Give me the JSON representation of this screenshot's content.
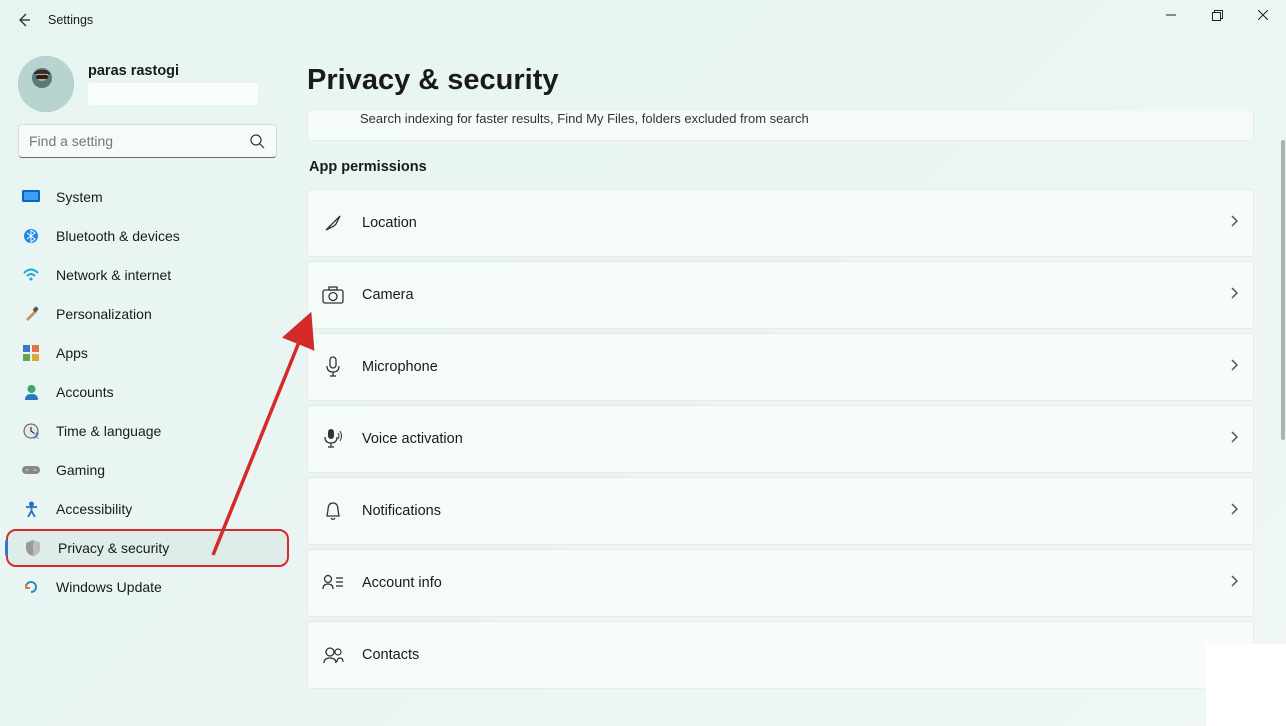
{
  "app_title": "Settings",
  "window_controls": {
    "minimize": "—",
    "maximize": "◻",
    "close": "✕"
  },
  "profile": {
    "name": "paras rastogi"
  },
  "search": {
    "placeholder": "Find a setting"
  },
  "sidebar": {
    "items": [
      {
        "label": "System",
        "icon": "monitor"
      },
      {
        "label": "Bluetooth & devices",
        "icon": "bluetooth"
      },
      {
        "label": "Network & internet",
        "icon": "wifi"
      },
      {
        "label": "Personalization",
        "icon": "brush"
      },
      {
        "label": "Apps",
        "icon": "apps"
      },
      {
        "label": "Accounts",
        "icon": "person"
      },
      {
        "label": "Time & language",
        "icon": "clock"
      },
      {
        "label": "Gaming",
        "icon": "gamepad"
      },
      {
        "label": "Accessibility",
        "icon": "accessibility"
      },
      {
        "label": "Privacy & security",
        "icon": "shield",
        "active": true,
        "highlighted": true
      },
      {
        "label": "Windows Update",
        "icon": "update"
      }
    ]
  },
  "page": {
    "title": "Privacy & security",
    "top_card_desc": "Search indexing for faster results, Find My Files, folders excluded from search",
    "section_heading": "App permissions",
    "permissions": [
      {
        "label": "Location",
        "icon": "location"
      },
      {
        "label": "Camera",
        "icon": "camera"
      },
      {
        "label": "Microphone",
        "icon": "mic"
      },
      {
        "label": "Voice activation",
        "icon": "voice"
      },
      {
        "label": "Notifications",
        "icon": "bell"
      },
      {
        "label": "Account info",
        "icon": "accountinfo"
      },
      {
        "label": "Contacts",
        "icon": "contacts"
      }
    ]
  }
}
